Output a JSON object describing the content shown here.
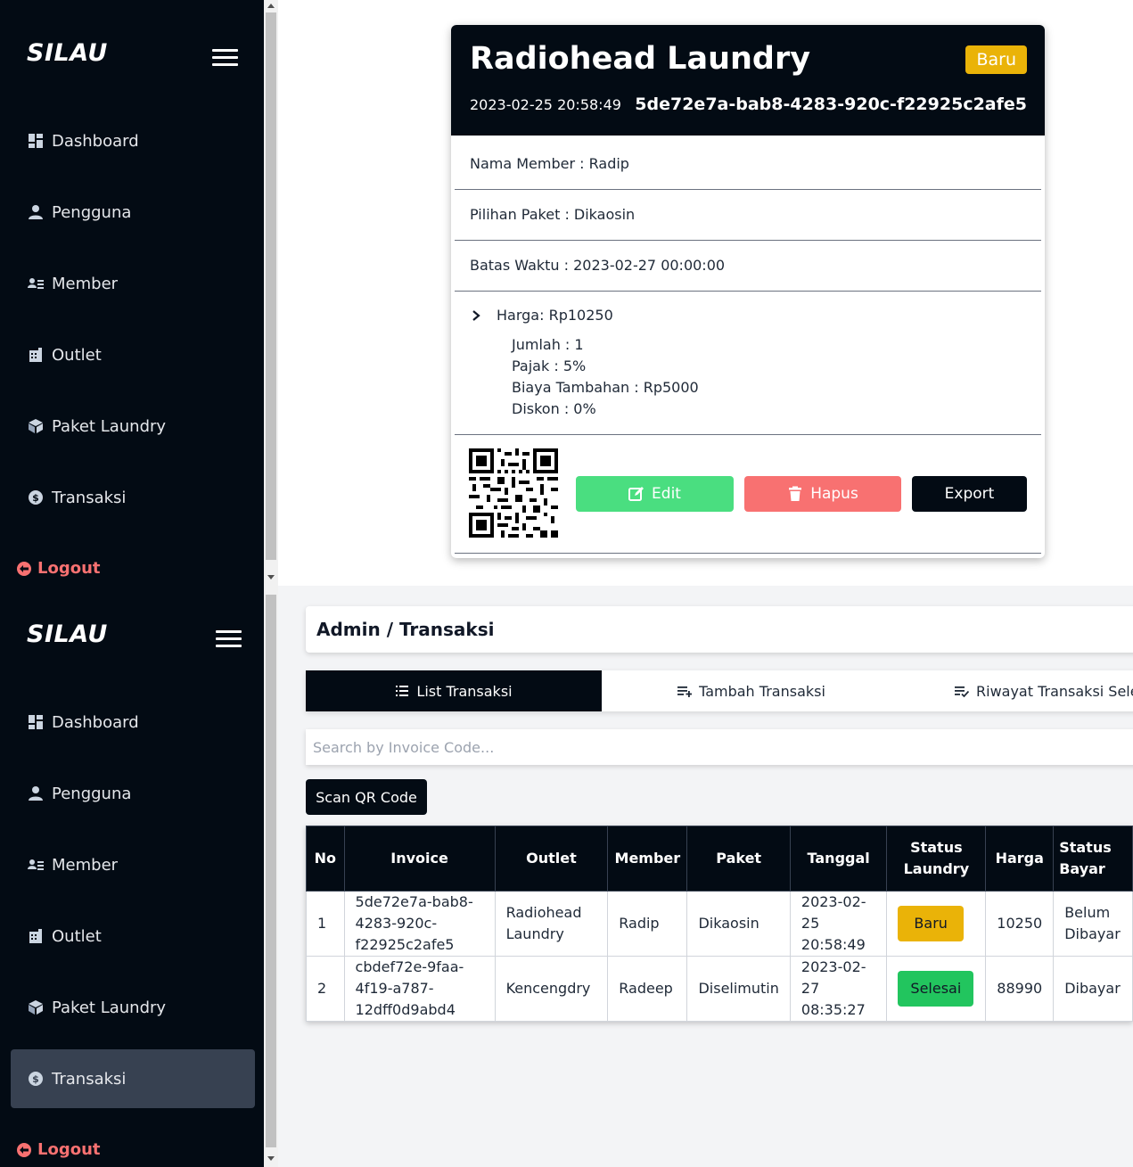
{
  "app": {
    "brand": "SILAU"
  },
  "sidebar": {
    "items": [
      {
        "label": "Dashboard",
        "icon": "dashboard-icon"
      },
      {
        "label": "Pengguna",
        "icon": "user-icon"
      },
      {
        "label": "Member",
        "icon": "member-list-icon"
      },
      {
        "label": "Outlet",
        "icon": "building-icon"
      },
      {
        "label": "Paket Laundry",
        "icon": "package-icon"
      },
      {
        "label": "Transaksi",
        "icon": "dollar-circle-icon"
      }
    ],
    "logout_label": "Logout",
    "active_item_bottom": "Transaksi"
  },
  "detail": {
    "title": "Radiohead Laundry",
    "status_badge": "Baru",
    "date": "2023-02-25 20:58:49",
    "invoice": "5de72e7a-bab8-4283-920c-f22925c2afe5",
    "member": "Nama Member : Radip",
    "paket": "Pilihan Paket : Dikaosin",
    "batas_waktu": "Batas Waktu : 2023-02-27 00:00:00",
    "harga": "Harga: Rp10250",
    "jumlah": "Jumlah : 1",
    "pajak": "Pajak : 5%",
    "biaya_tambahan": "Biaya Tambahan : Rp5000",
    "diskon": "Diskon : 0%",
    "buttons": {
      "edit": "Edit",
      "hapus": "Hapus",
      "export": "Export"
    }
  },
  "main": {
    "breadcrumb": "Admin / Transaksi",
    "tabs": [
      {
        "label": "List Transaksi",
        "active": true
      },
      {
        "label": "Tambah Transaksi",
        "active": false
      },
      {
        "label": "Riwayat Transaksi Selesai",
        "active": false
      }
    ],
    "search_placeholder": "Search by Invoice Code...",
    "scan_button": "Scan QR Code",
    "table": {
      "headers": [
        "No",
        "Invoice",
        "Outlet",
        "Member",
        "Paket",
        "Tanggal",
        "Status Laundry",
        "Harga",
        "Status Bayar"
      ],
      "rows": [
        {
          "no": "1",
          "invoice": "5de72e7a-bab8-4283-920c-f22925c2afe5",
          "outlet": "Radiohead Laundry",
          "member": "Radip",
          "paket": "Dikaosin",
          "tanggal": "2023-02-25 20:58:49",
          "status": "Baru",
          "harga": "10250",
          "bayar": "Belum Dibayar"
        },
        {
          "no": "2",
          "invoice": "cbdef72e-9faa-4f19-a787-12dff0d9abd4",
          "outlet": "Kencengdry",
          "member": "Radeep",
          "paket": "Diselimutin",
          "tanggal": "2023-02-27 08:35:27",
          "status": "Selesai",
          "harga": "88990",
          "bayar": "Dibayar"
        }
      ]
    }
  },
  "colors": {
    "sidebar_bg": "#030b14",
    "accent_dark": "#030b14",
    "baru": "#eab308",
    "selesai": "#22c55e",
    "edit": "#4ade80",
    "hapus": "#f87171",
    "logout": "#f87171"
  }
}
